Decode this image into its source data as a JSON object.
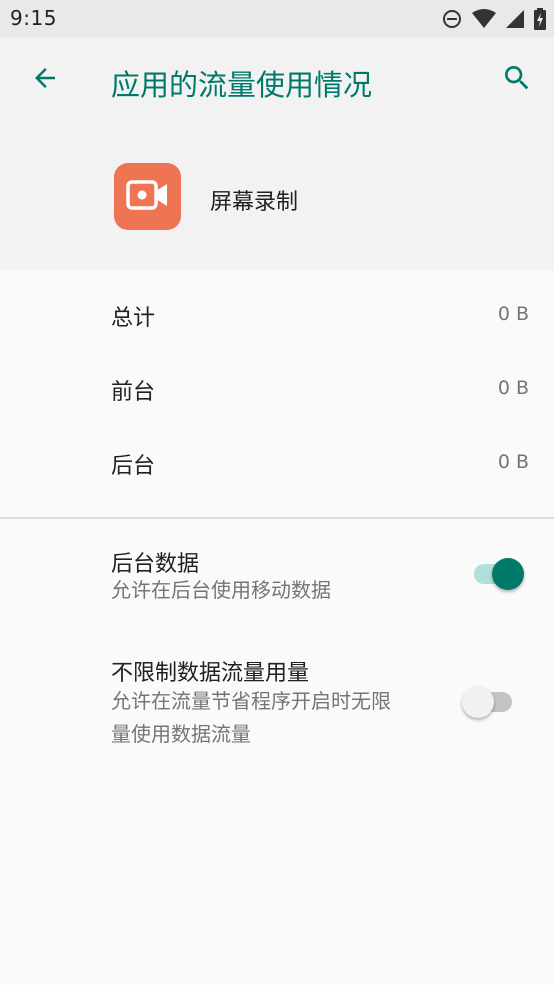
{
  "status_bar": {
    "time": "9:15",
    "icons": [
      "do-not-disturb-icon",
      "wifi-icon",
      "cell-signal-icon",
      "battery-charging-icon"
    ]
  },
  "app_bar": {
    "title": "应用的流量使用情况",
    "back_icon": "arrow-back-icon",
    "search_icon": "search-icon",
    "accent_color": "#00796b"
  },
  "app": {
    "name": "屏幕录制",
    "icon": "video-camera-icon",
    "icon_color": "#ef7453"
  },
  "usage": [
    {
      "label": "总计",
      "value": "0 B"
    },
    {
      "label": "前台",
      "value": "0 B"
    },
    {
      "label": "后台",
      "value": "0 B"
    }
  ],
  "settings": {
    "background_data": {
      "title": "后台数据",
      "summary": "允许在后台使用移动数据",
      "enabled": true
    },
    "unrestricted_data": {
      "title": "不限制数据流量用量",
      "summary_line1": "允许在流量节省程序开启时无限",
      "summary_line2": "量使用数据流量",
      "enabled": false
    }
  }
}
